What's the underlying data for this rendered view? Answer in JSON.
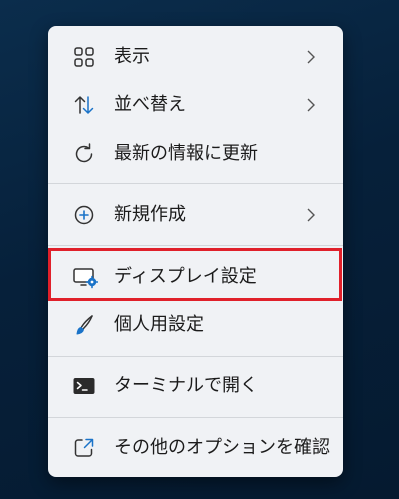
{
  "context_menu": {
    "items": [
      {
        "label": "表示",
        "icon": "grid-icon",
        "has_submenu": true
      },
      {
        "label": "並べ替え",
        "icon": "sort-icon",
        "has_submenu": true
      },
      {
        "label": "最新の情報に更新",
        "icon": "refresh-icon",
        "has_submenu": false
      },
      {
        "label": "新規作成",
        "icon": "new-plus-icon",
        "has_submenu": true
      },
      {
        "label": "ディスプレイ設定",
        "icon": "display-settings-icon",
        "has_submenu": false
      },
      {
        "label": "個人用設定",
        "icon": "brush-icon",
        "has_submenu": false
      },
      {
        "label": "ターミナルで開く",
        "icon": "terminal-icon",
        "has_submenu": false
      },
      {
        "label": "その他のオプションを確認",
        "icon": "more-options-icon",
        "has_submenu": false
      }
    ],
    "highlighted_item": "ディスプレイ設定"
  },
  "colors": {
    "desktop_background": "#082540",
    "menu_background": "#f0f2f5",
    "highlight_border": "#e0202a",
    "accent_blue": "#1a73c8"
  }
}
